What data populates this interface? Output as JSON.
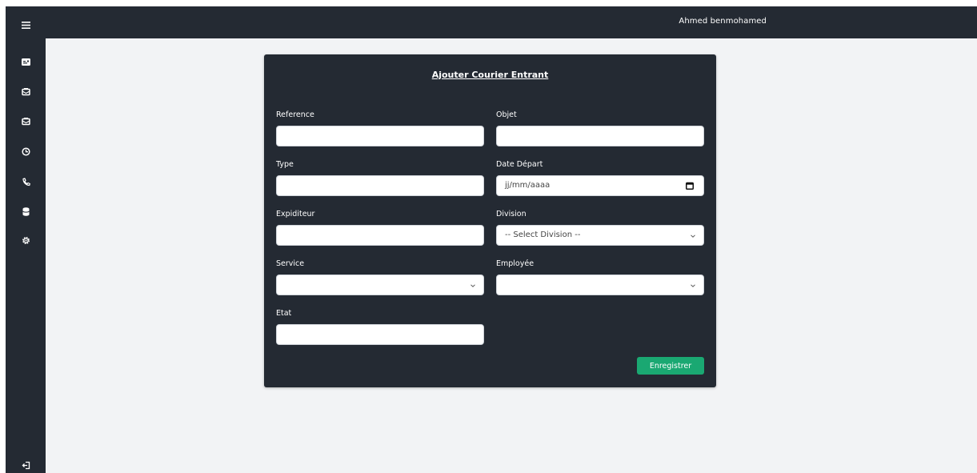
{
  "topbar": {
    "user_name": "Ahmed benmohamed"
  },
  "sidebar": {
    "items": [
      {
        "icon": "menu-icon"
      },
      {
        "icon": "id-card-icon"
      },
      {
        "icon": "mail-in-icon"
      },
      {
        "icon": "mail-out-icon"
      },
      {
        "icon": "clock-icon"
      },
      {
        "icon": "phone-icon"
      },
      {
        "icon": "database-icon"
      },
      {
        "icon": "gear-icon"
      },
      {
        "icon": "logout-icon"
      }
    ]
  },
  "form": {
    "title": "Ajouter Courier Entrant",
    "fields": {
      "reference": {
        "label": "Reference",
        "value": ""
      },
      "objet": {
        "label": "Objet",
        "value": ""
      },
      "type": {
        "label": "Type",
        "value": ""
      },
      "date_depart": {
        "label": "Date Départ",
        "placeholder": "jj/mm/aaaa"
      },
      "expediteur": {
        "label": "Expiditeur",
        "value": ""
      },
      "division": {
        "label": "Division",
        "selected": "-- Select Division --"
      },
      "service": {
        "label": "Service",
        "selected": ""
      },
      "employee": {
        "label": "Employée",
        "selected": ""
      },
      "etat": {
        "label": "Etat",
        "value": ""
      }
    },
    "submit_label": "Enregistrer"
  },
  "colors": {
    "dark_panel": "#242a33",
    "background": "#f2f3f5",
    "accent_green": "#1aa872"
  }
}
